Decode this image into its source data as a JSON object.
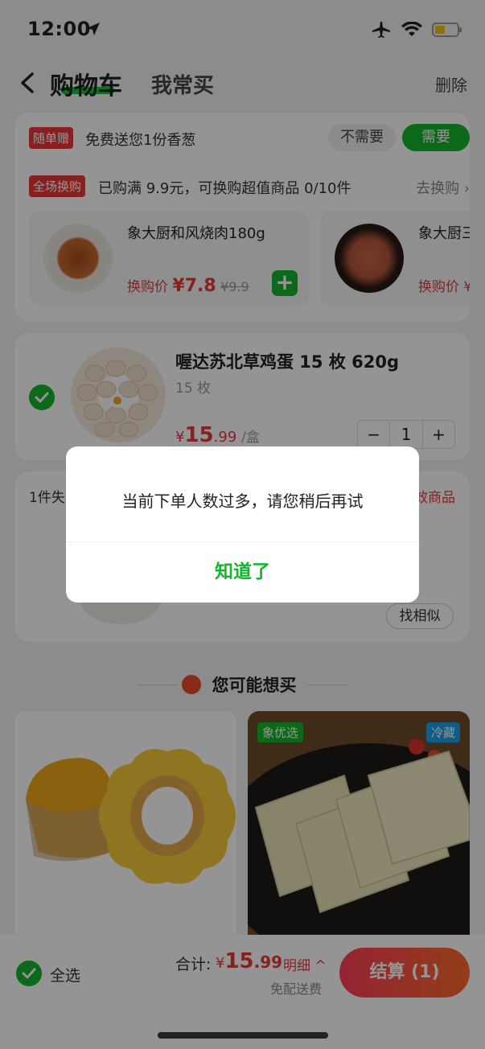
{
  "status_bar": {
    "time": "12:00"
  },
  "header": {
    "title": "购物车",
    "tab_frequent": "我常买",
    "delete": "删除"
  },
  "promo": {
    "gift_tag": "随单赠",
    "gift_text": "免费送您1份香葱",
    "no_label": "不需要",
    "yes_label": "需要",
    "exchange_tag": "全场换购",
    "exchange_text": "已购满 9.9元，可换购超值商品 0/10件",
    "go_exchange": "去换购 ›",
    "products": [
      {
        "name": "象大厨和风烧肉180g",
        "price_label": "换购价",
        "price": "¥7.8",
        "old_price": "¥9.9"
      },
      {
        "name": "象大厨三",
        "price_label": "换购价 ¥",
        "price": "",
        "old_price": ""
      }
    ]
  },
  "cart_item": {
    "title": "喔达苏北草鸡蛋 15 枚 620g",
    "spec": "15 枚",
    "price_symbol": "¥",
    "price_main": "15",
    "price_decimal": ".99",
    "unit": "/盒",
    "qty": "1",
    "minus": "−",
    "plus": "+"
  },
  "expired": {
    "label": "1件失",
    "clear": "效商品",
    "find_similar": "找相似"
  },
  "recommend": {
    "title": "您可能想买",
    "tag_left": "象优选",
    "tag_right": "冷藏"
  },
  "bottom_bar": {
    "select_all": "全选",
    "total_label": "合计:",
    "total_symbol": "¥",
    "total_main": "15",
    "total_decimal": ".99",
    "detail": "明细 ^",
    "free_delivery": "免配送费",
    "checkout": "结算 (1)"
  },
  "dialog": {
    "message": "当前下单人数过多，请您稍后再试",
    "confirm": "知道了"
  },
  "colors": {
    "accent": "#13b52c",
    "price": "#e83a3a"
  }
}
